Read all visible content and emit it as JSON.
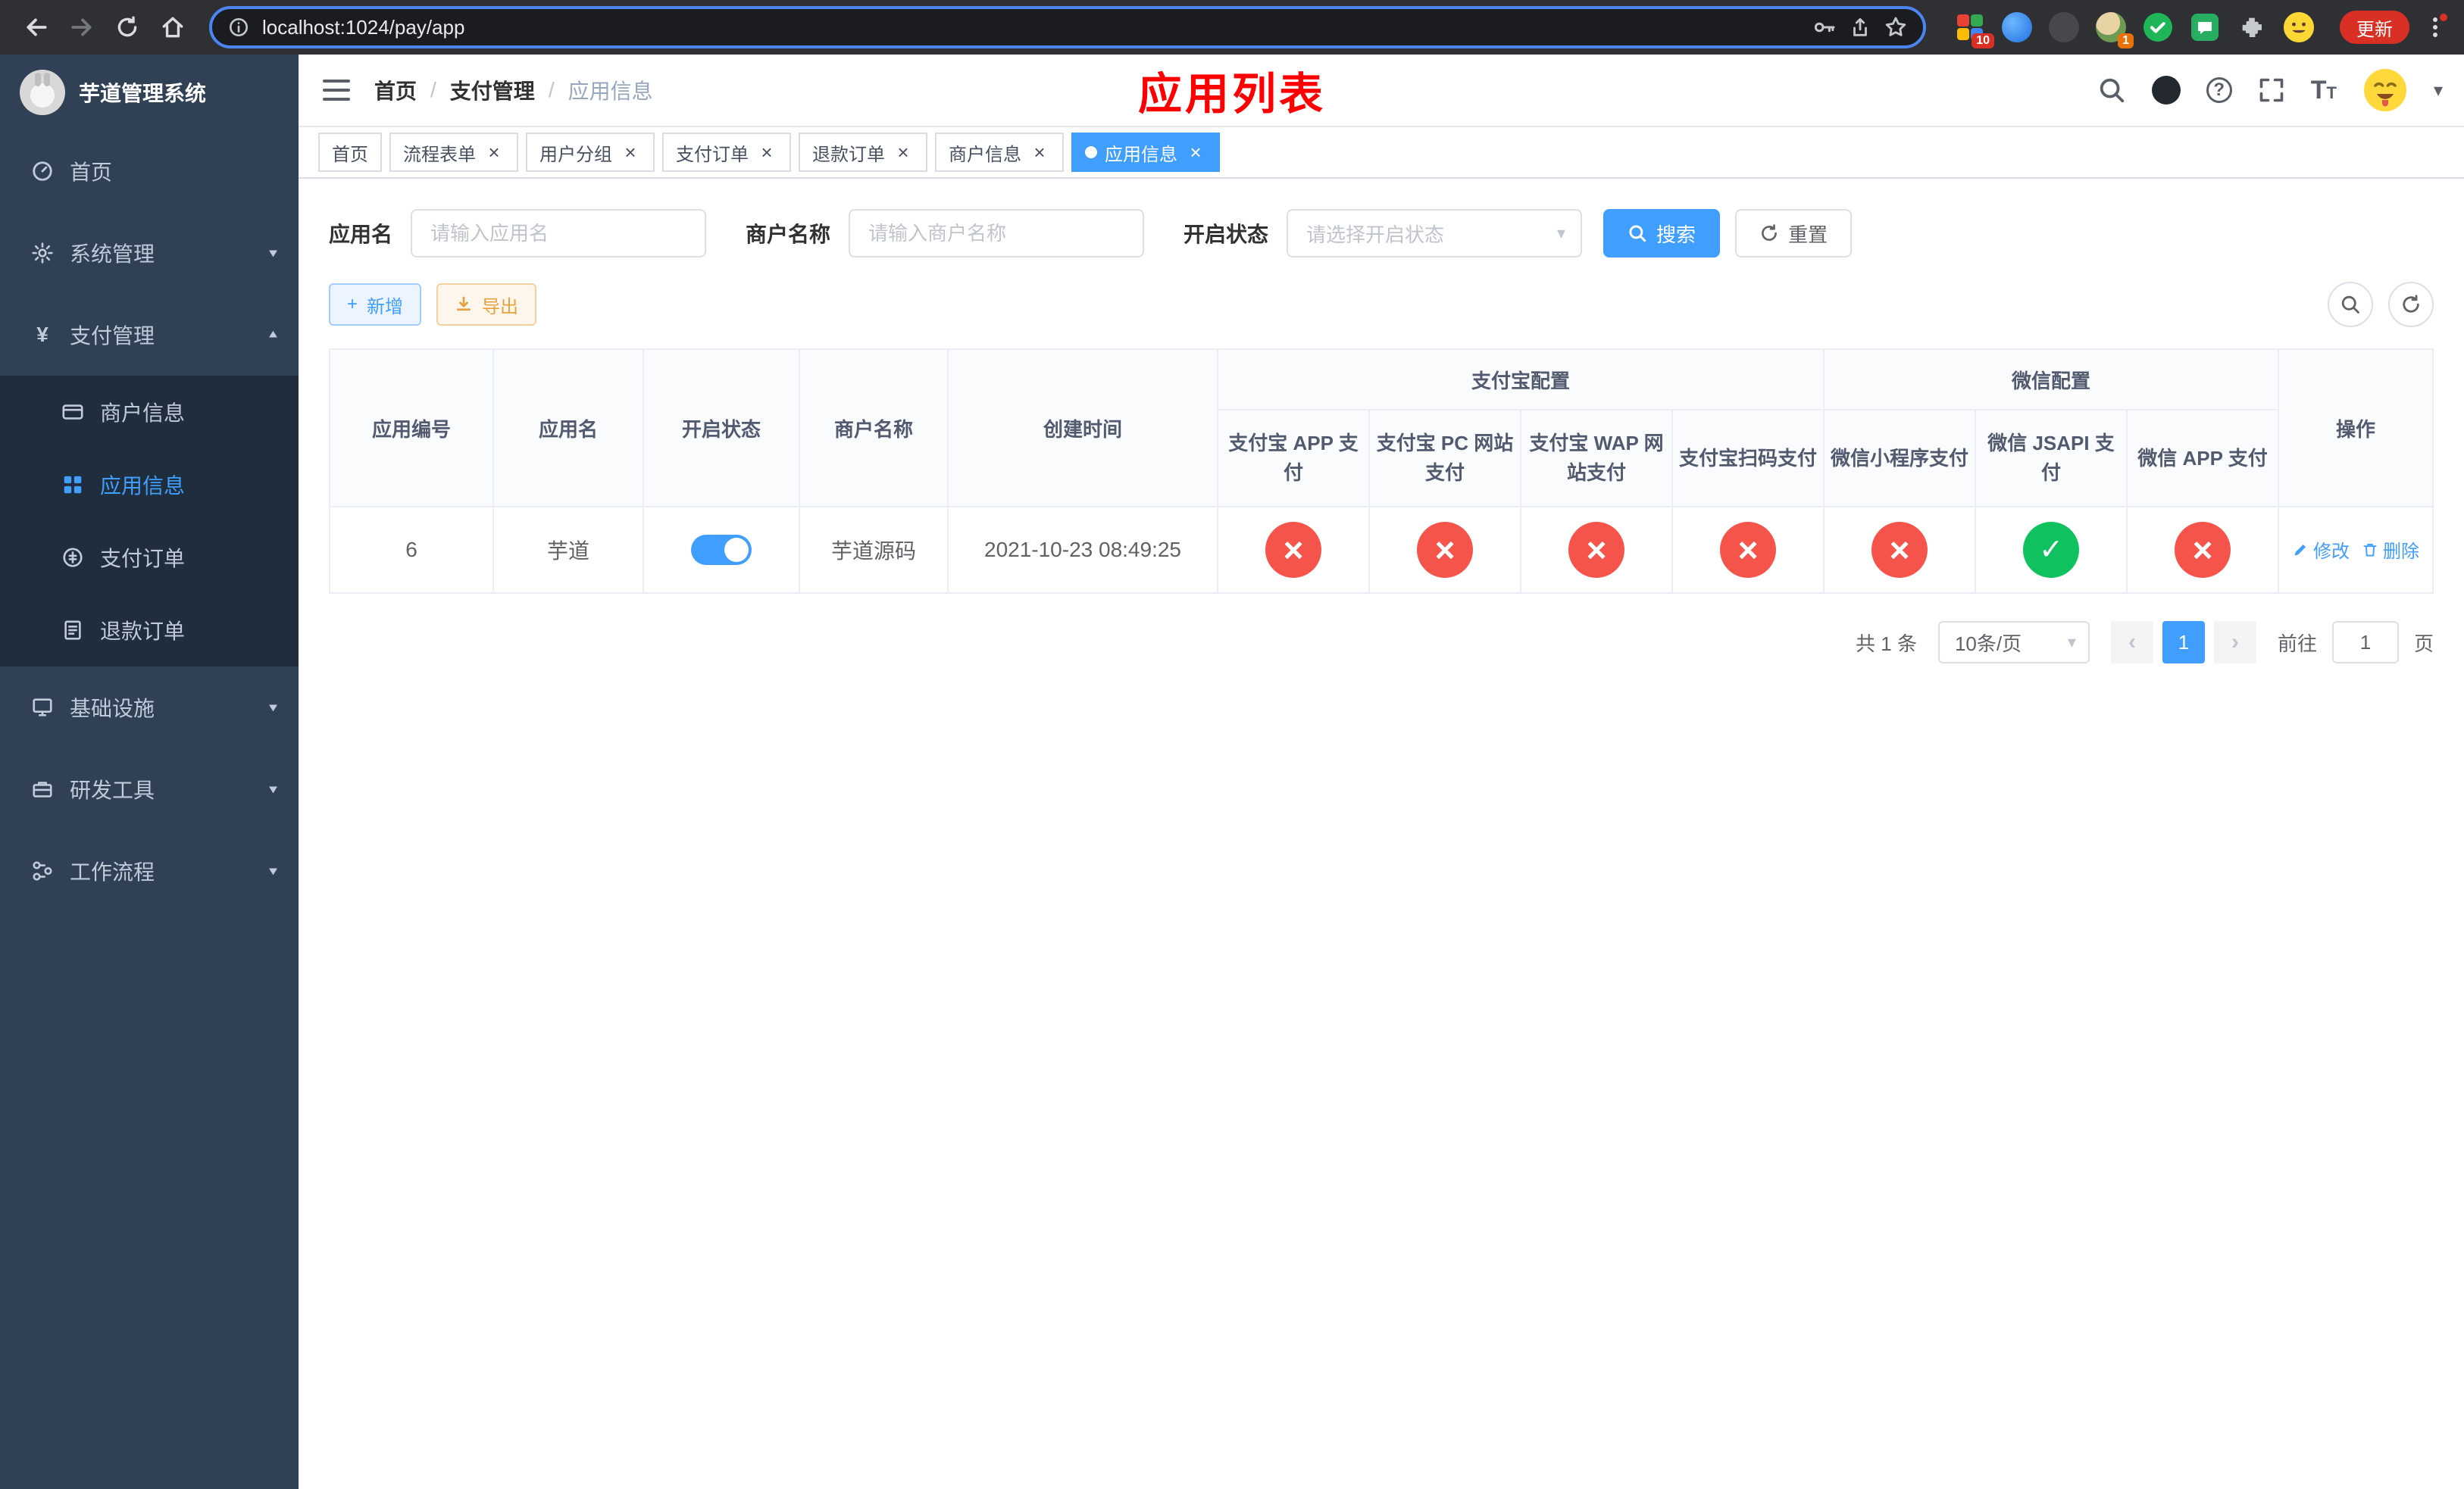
{
  "browser": {
    "url": "localhost:1024/pay/app",
    "update_button": "更新",
    "badges": {
      "extensions_grid": "10",
      "profile_ext": "1"
    }
  },
  "colors": {
    "accent": "#409eff",
    "danger": "#f4544a",
    "success": "#0fc25f",
    "warning": "#e6a23c",
    "title_red": "#ff0000",
    "sidebar_bg": "#304156",
    "submenu_bg": "#1f2d3d"
  },
  "icons": {
    "close": "×",
    "check": "✓",
    "caret": "▾",
    "prev": "‹",
    "next": "›",
    "plus": "+",
    "yen": "¥",
    "question": "?",
    "slash": "/",
    "font_size": "T"
  },
  "sidebar": {
    "logo_title": "芋道管理系统",
    "active": "应用信息",
    "items": [
      {
        "label": "首页"
      },
      {
        "label": "系统管理"
      },
      {
        "label": "支付管理"
      },
      {
        "label": "基础设施"
      },
      {
        "label": "研发工具"
      },
      {
        "label": "工作流程"
      }
    ],
    "submenu": [
      {
        "label": "商户信息"
      },
      {
        "label": "应用信息"
      },
      {
        "label": "支付订单"
      },
      {
        "label": "退款订单"
      }
    ]
  },
  "header": {
    "breadcrumb": [
      "首页",
      "支付管理",
      "应用信息"
    ],
    "page_title": "应用列表"
  },
  "tabs": {
    "active": "应用信息",
    "items": [
      {
        "label": "首页"
      },
      {
        "label": "流程表单"
      },
      {
        "label": "用户分组"
      },
      {
        "label": "支付订单"
      },
      {
        "label": "退款订单"
      },
      {
        "label": "商户信息"
      },
      {
        "label": "应用信息"
      }
    ]
  },
  "filters": {
    "app_name_label": "应用名",
    "app_name_placeholder": "请输入应用名",
    "merchant_label": "商户名称",
    "merchant_placeholder": "请输入商户名称",
    "status_label": "开启状态",
    "status_placeholder": "请选择开启状态",
    "search_label": "搜索",
    "reset_label": "重置"
  },
  "toolbar": {
    "add_label": "新增",
    "export_label": "导出"
  },
  "table": {
    "headers": {
      "id": "应用编号",
      "name": "应用名",
      "status": "开启状态",
      "merchant": "商户名称",
      "created": "创建时间",
      "alipay_group": "支付宝配置",
      "wechat_group": "微信配置",
      "alipay_app": "支付宝 APP 支付",
      "alipay_pc": "支付宝 PC 网站支付",
      "alipay_wap": "支付宝 WAP 网站支付",
      "alipay_qr": "支付宝扫码支付",
      "wx_lite": "微信小程序支付",
      "wx_jsapi": "微信 JSAPI 支付",
      "wx_app": "微信 APP 支付",
      "actions": "操作"
    },
    "row": {
      "id": "6",
      "name": "芋道",
      "switch_state": "on",
      "merchant": "芋道源码",
      "created": "2021-10-23 08:49:25",
      "channels": [
        "no",
        "no",
        "no",
        "no",
        "no",
        "yes",
        "no"
      ],
      "edit": "修改",
      "delete": "删除"
    }
  },
  "pagination": {
    "total": "共 1 条",
    "page_size": "10条/页",
    "page": "1",
    "goto": "前往",
    "goto_value": "1",
    "unit": "页"
  }
}
